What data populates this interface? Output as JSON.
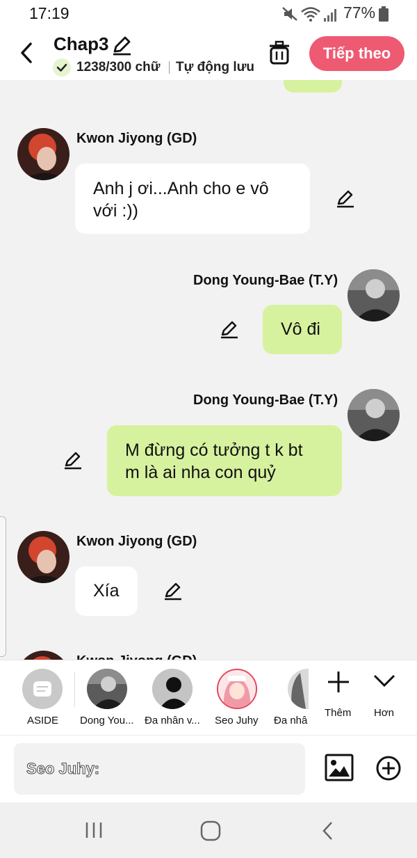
{
  "status_bar": {
    "time": "17:19",
    "battery": "77%"
  },
  "header": {
    "title": "Chap3",
    "word_count": "1238/300 chữ",
    "autosave": "Tự động lưu",
    "next_label": "Tiếp theo"
  },
  "chat": {
    "messages": [
      {
        "sender": "Kwon Jiyong (GD)",
        "text_lines": [
          "Anh j ơi...Anh cho e vô",
          "với :))"
        ]
      },
      {
        "sender": "Dong Young-Bae (T.Y)",
        "text_lines": [
          "Vô đi"
        ]
      },
      {
        "sender": "Dong Young-Bae (T.Y)",
        "text_lines": [
          "M đừng có tưởng t k bt",
          "m là ai nha con quỷ"
        ]
      },
      {
        "sender": "Kwon Jiyong (GD)",
        "text_lines": [
          "Xía"
        ]
      },
      {
        "sender": "Kwon Jiyong (GD)"
      }
    ]
  },
  "characters": {
    "items": [
      {
        "label": "ASIDE"
      },
      {
        "label": "Dong You..."
      },
      {
        "label": "Đa nhân v..."
      },
      {
        "label": "Seo Juhy"
      },
      {
        "label": "Đa nhâ"
      }
    ],
    "more_label": "Thêm",
    "less_label": "Hơn"
  },
  "input": {
    "placeholder": "Seo Juhy:"
  },
  "colors": {
    "accent": "#ee5a72",
    "bubble_green": "#d7f29f",
    "bubble_white": "#ffffff",
    "check_badge": "#e4f4d0"
  }
}
